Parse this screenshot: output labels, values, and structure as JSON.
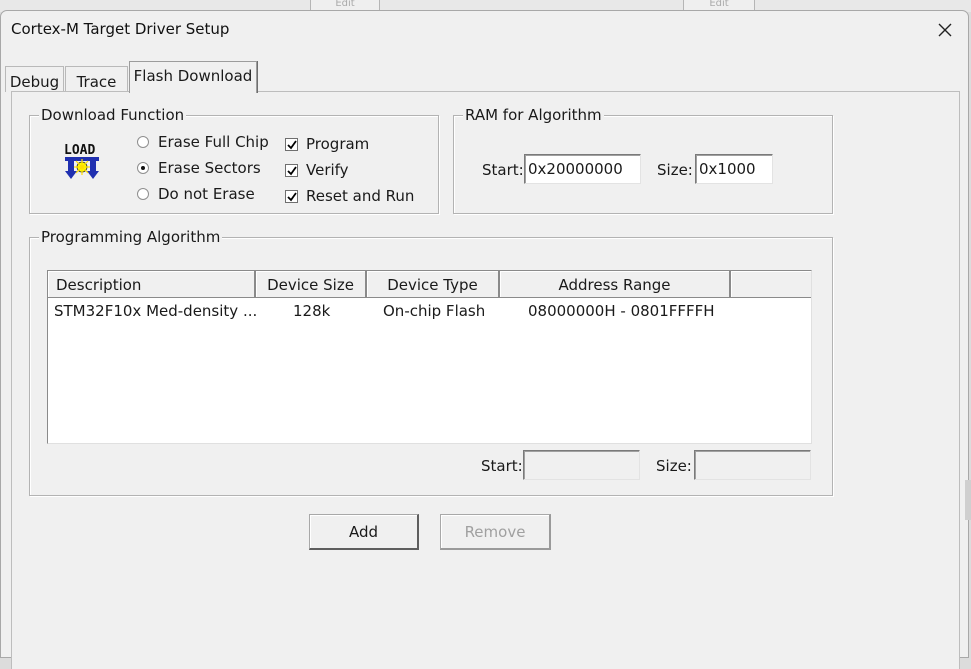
{
  "window": {
    "title": "Cortex-M Target Driver Setup"
  },
  "background": {
    "edit1": "Edit",
    "edit2": "Edit"
  },
  "tabs": [
    {
      "label": "Debug",
      "active": false
    },
    {
      "label": "Trace",
      "active": false
    },
    {
      "label": "Flash Download",
      "active": true
    }
  ],
  "download_function": {
    "legend": "Download Function",
    "load_icon_text": "LOAD",
    "radios": [
      {
        "label": "Erase Full Chip",
        "selected": false
      },
      {
        "label": "Erase Sectors",
        "selected": true
      },
      {
        "label": "Do not Erase",
        "selected": false
      }
    ],
    "checks": [
      {
        "label": "Program",
        "checked": true
      },
      {
        "label": "Verify",
        "checked": true
      },
      {
        "label": "Reset and Run",
        "checked": true
      }
    ]
  },
  "ram": {
    "legend": "RAM for Algorithm",
    "start_label": "Start:",
    "start_value": "0x20000000",
    "size_label": "Size:",
    "size_value": "0x1000"
  },
  "algorithm": {
    "legend": "Programming Algorithm",
    "columns": [
      "Description",
      "Device Size",
      "Device Type",
      "Address Range"
    ],
    "rows": [
      [
        "STM32F10x Med-density ...",
        "128k",
        "On-chip Flash",
        "08000000H - 0801FFFFH"
      ]
    ],
    "start_label": "Start:",
    "start_value": "",
    "size_label": "Size:",
    "size_value": ""
  },
  "buttons": {
    "add": "Add",
    "remove": "Remove"
  },
  "colors": {
    "window_bg": "#f0f0f0",
    "disabled_text": "#a0a0a0"
  }
}
